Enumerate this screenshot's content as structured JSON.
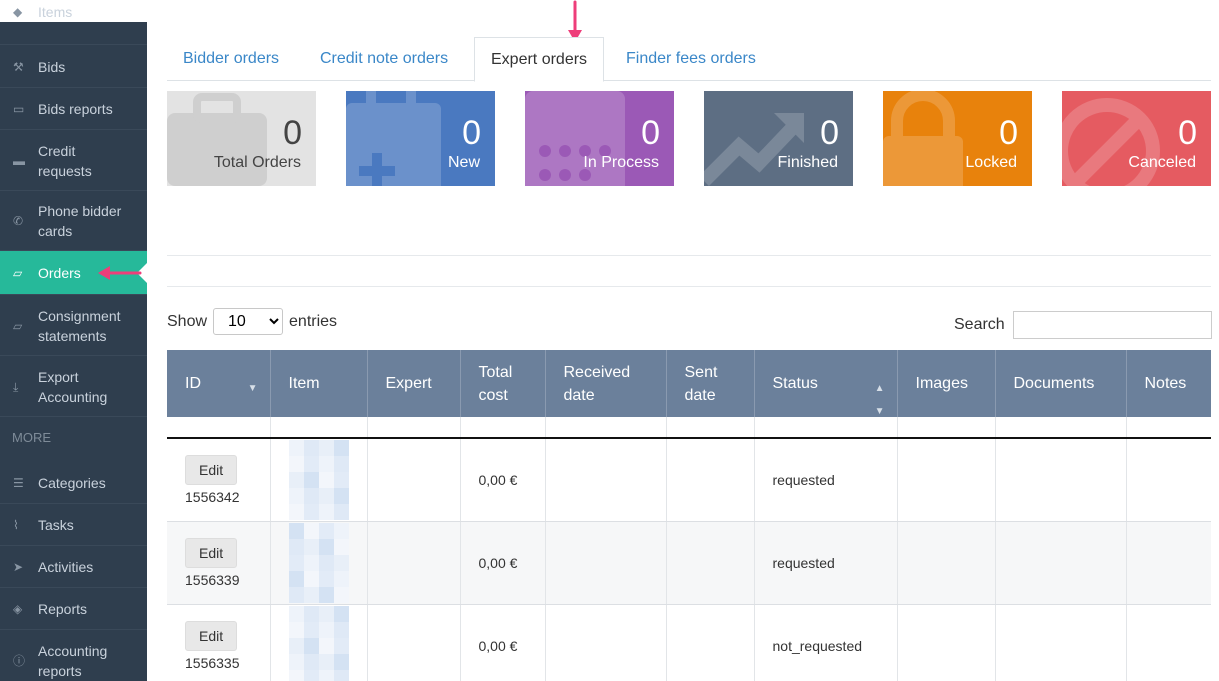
{
  "sidebar": {
    "items": [
      {
        "label": "Items",
        "icon": "tag-icon"
      },
      {
        "label": "Bids",
        "icon": "gavel-icon"
      },
      {
        "label": "Bids reports",
        "icon": "money-icon"
      },
      {
        "label": "Credit requests",
        "icon": "credit-card-icon"
      },
      {
        "label": "Phone bidder cards",
        "icon": "phone-icon"
      },
      {
        "label": "Orders",
        "icon": "folder-icon"
      },
      {
        "label": "Consignment statements",
        "icon": "folder-icon"
      },
      {
        "label": "Export Accounting",
        "icon": "download-icon"
      },
      {
        "label": "Categories",
        "icon": "list-icon"
      },
      {
        "label": "Tasks",
        "icon": "paperclip-icon"
      },
      {
        "label": "Activities",
        "icon": "paper-plane-icon"
      },
      {
        "label": "Reports",
        "icon": "layers-icon"
      },
      {
        "label": "Accounting reports",
        "icon": "info-icon"
      }
    ],
    "section_label": "MORE",
    "active_item": "Orders"
  },
  "tabs": [
    {
      "label": "Bidder orders"
    },
    {
      "label": "Credit note orders"
    },
    {
      "label": "Expert orders"
    },
    {
      "label": "Finder fees orders"
    }
  ],
  "active_tab": "Expert orders",
  "tiles": [
    {
      "value": "0",
      "label": "Total Orders",
      "color": "#e3e3e3"
    },
    {
      "value": "0",
      "label": "New",
      "color": "#4a79c0"
    },
    {
      "value": "0",
      "label": "In Process",
      "color": "#9b59b6"
    },
    {
      "value": "0",
      "label": "Finished",
      "color": "#5d6e83"
    },
    {
      "value": "0",
      "label": "Locked",
      "color": "#e8820c"
    },
    {
      "value": "0",
      "label": "Canceled",
      "color": "#e55b61"
    }
  ],
  "controls": {
    "show_label": "Show",
    "entries_value": "10",
    "entries_label": "entries",
    "search_label": "Search",
    "search_value": ""
  },
  "table": {
    "columns": [
      "ID",
      "Item",
      "Expert",
      "Total cost",
      "Received date",
      "Sent date",
      "Status",
      "Images",
      "Documents",
      "Notes"
    ],
    "edit_label": "Edit",
    "rows": [
      {
        "id": "1556342",
        "total_cost": "0,00 €",
        "status": "requested"
      },
      {
        "id": "1556339",
        "total_cost": "0,00 €",
        "status": "requested"
      },
      {
        "id": "1556335",
        "total_cost": "0,00 €",
        "status": "not_requested"
      }
    ]
  },
  "colors": {
    "sidebar_bg": "#2f3e4e",
    "active_green": "#26b99a",
    "header_blue": "#6b809b",
    "link_blue": "#3a87c8",
    "annotation_pink": "#ee3e7a"
  }
}
